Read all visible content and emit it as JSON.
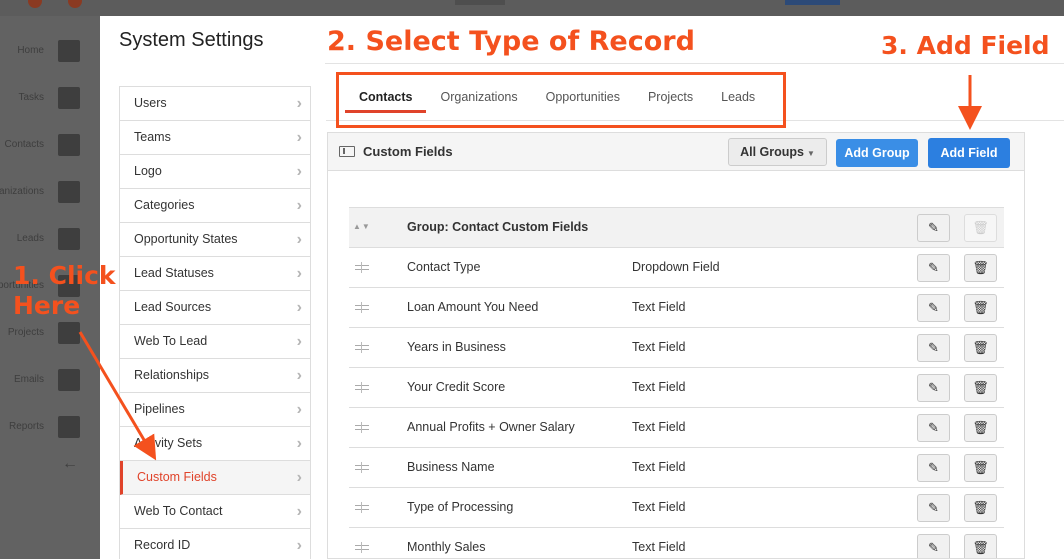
{
  "background_app": {
    "nav_items": [
      {
        "label": "Home",
        "icon": "home-icon"
      },
      {
        "label": "Tasks",
        "icon": "tasks-icon"
      },
      {
        "label": "Contacts",
        "icon": "contacts-icon"
      },
      {
        "label": "Organizations",
        "icon": "organizations-icon"
      },
      {
        "label": "Leads",
        "icon": "leads-icon"
      },
      {
        "label": "Opportunities",
        "icon": "opportunities-icon"
      },
      {
        "label": "Projects",
        "icon": "projects-icon"
      },
      {
        "label": "Emails",
        "icon": "emails-icon"
      },
      {
        "label": "Reports",
        "icon": "reports-icon"
      }
    ],
    "collapse_glyph": "←"
  },
  "modal": {
    "title": "System Settings",
    "menu": [
      {
        "label": "Users"
      },
      {
        "label": "Teams"
      },
      {
        "label": "Logo"
      },
      {
        "label": "Categories"
      },
      {
        "label": "Opportunity States"
      },
      {
        "label": "Lead Statuses"
      },
      {
        "label": "Lead Sources"
      },
      {
        "label": "Web To Lead"
      },
      {
        "label": "Relationships"
      },
      {
        "label": "Pipelines"
      },
      {
        "label": "Activity Sets"
      },
      {
        "label": "Custom Fields",
        "active": true
      },
      {
        "label": "Web To Contact"
      },
      {
        "label": "Record ID"
      }
    ],
    "tabs": [
      {
        "label": "Contacts",
        "active": true
      },
      {
        "label": "Organizations"
      },
      {
        "label": "Opportunities"
      },
      {
        "label": "Projects"
      },
      {
        "label": "Leads"
      }
    ],
    "panel": {
      "title": "Custom Fields",
      "all_groups_label": "All Groups",
      "add_group_label": "Add Group",
      "add_field_label": "Add Field",
      "group_label": "Group: Contact Custom Fields",
      "rows": [
        {
          "name": "Contact Type",
          "type": "Dropdown Field"
        },
        {
          "name": "Loan Amount You Need",
          "type": "Text Field"
        },
        {
          "name": "Years in Business",
          "type": "Text Field"
        },
        {
          "name": "Your Credit Score",
          "type": "Text Field"
        },
        {
          "name": "Annual Profits + Owner Salary",
          "type": "Text Field"
        },
        {
          "name": "Business Name",
          "type": "Text Field"
        },
        {
          "name": "Type of Processing",
          "type": "Text Field"
        },
        {
          "name": "Monthly Sales",
          "type": "Text Field"
        }
      ]
    }
  },
  "annotations": {
    "step1": "1. Click Here",
    "step2": "2. Select Type of Record",
    "step3": "3. Add Field",
    "color": "#f4511e"
  },
  "colors": {
    "accent": "#e0432a",
    "primary_button": "#2c7fe0"
  }
}
